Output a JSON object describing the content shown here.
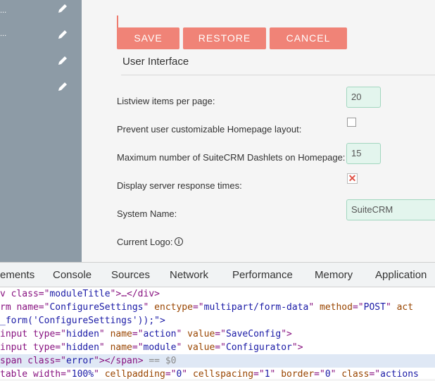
{
  "sidebar": {
    "rows": [
      "...",
      "...",
      "",
      ""
    ]
  },
  "buttons": {
    "save": "SAVE",
    "restore": "RESTORE",
    "cancel": "CANCEL"
  },
  "section": {
    "title": "User Interface"
  },
  "fields": {
    "listview_label": "Listview items per page:",
    "listview_value": "20",
    "prevent_label": "Prevent user customizable Homepage layout:",
    "dashlets_label": "Maximum number of SuiteCRM Dashlets on Homepage:",
    "dashlets_value": "15",
    "response_label": "Display server response times:",
    "system_name_label": "System Name:",
    "system_name_value": "SuiteCRM",
    "logo_label": "Current Logo:"
  },
  "devtools": {
    "tabs": [
      "ements",
      "Console",
      "Sources",
      "Network",
      "Performance",
      "Memory",
      "Application"
    ],
    "code": {
      "l1_tag": "v class",
      "l1_attr": "moduleTitle",
      "l1_rest": ">…</div>",
      "l2_a": "rm name",
      "l2_b": "ConfigureSettings",
      "l2_c": "enctype",
      "l2_d": "multipart/form-data",
      "l2_e": "method",
      "l2_f": "POST",
      "l2_g": "act",
      "l3": "_form('ConfigureSettings'));\">",
      "l4_a": "input type",
      "l4_b": "hidden",
      "l4_c": "name",
      "l4_d": "action",
      "l4_e": "value",
      "l4_f": "SaveConfig",
      "l5_a": "input type",
      "l5_b": "hidden",
      "l5_c": "name",
      "l5_d": "module",
      "l5_e": "value",
      "l5_f": "Configurator",
      "l6_a": "span class",
      "l6_b": "error",
      "l6_c": "></span>",
      "l6_d": "== $0",
      "l7_a": "table width",
      "l7_b": "100%",
      "l7_c": "cellpadding",
      "l7_d": "0",
      "l7_e": "cellspacing",
      "l7_f": "1",
      "l7_g": "border",
      "l7_h": "0",
      "l7_i": "class",
      "l7_j": "actions"
    }
  },
  "colors": {
    "accent": "#f08377",
    "sidebar": "#8d9ba6",
    "field_bg": "#e3f5ed"
  }
}
